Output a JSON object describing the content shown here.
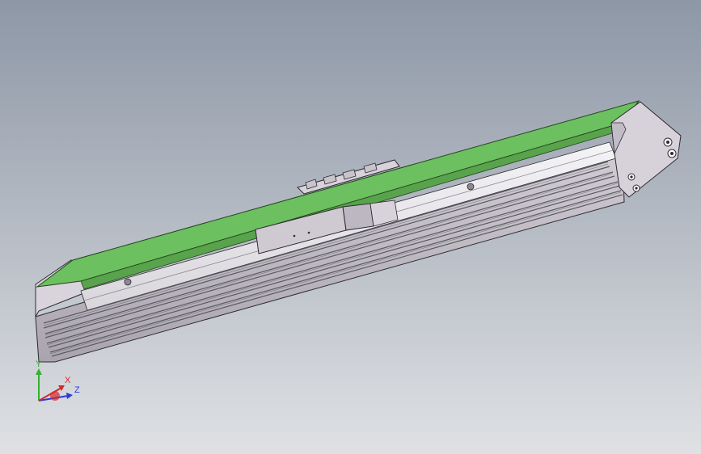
{
  "viewport": {
    "background_top": "#8d97a6",
    "background_bottom": "#dfe1e4"
  },
  "model": {
    "cover_color": "#6cc05f",
    "body_color": "#c9c4cc",
    "end_cap_color": "#d7d1da",
    "slot_color": "#5b5a62"
  },
  "triad": {
    "x_label": "X",
    "y_label": "Y",
    "z_label": "Z",
    "x_color": "#d8282a",
    "y_color": "#33b12f",
    "z_color": "#2a3bd6"
  }
}
